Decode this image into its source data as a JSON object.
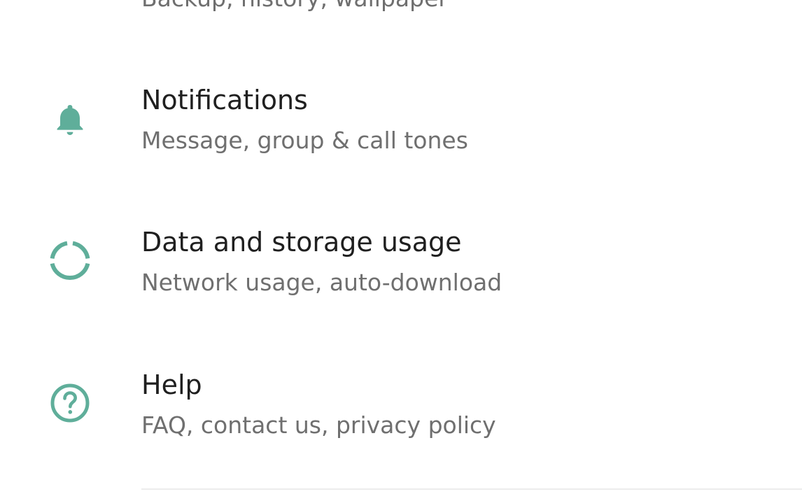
{
  "colors": {
    "accent": "#5fae9a",
    "title_text": "#1f1f1f",
    "subtitle_text": "#6f6f6f",
    "divider": "#ececec"
  },
  "settings": {
    "chats": {
      "subtitle": "Backup, history, wallpaper"
    },
    "notifications": {
      "icon": "bell-icon",
      "title": "Notifications",
      "subtitle": "Message, group & call tones"
    },
    "data_storage": {
      "icon": "data-usage-icon",
      "title": "Data and storage usage",
      "subtitle": "Network usage, auto-download"
    },
    "help": {
      "icon": "help-circle-icon",
      "title": "Help",
      "subtitle": "FAQ, contact us, privacy policy"
    }
  }
}
